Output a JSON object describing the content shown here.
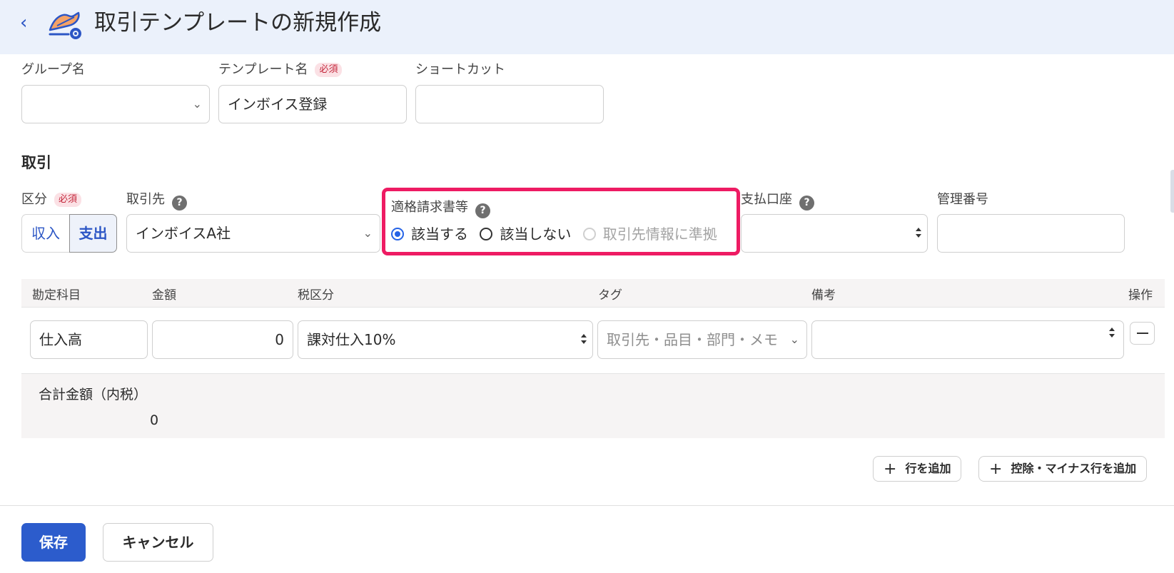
{
  "header": {
    "title": "取引テンプレートの新規作成",
    "back_icon": "chevron-left-icon",
    "logo_icon": "template-gear-icon"
  },
  "template": {
    "group_label": "グループ名",
    "group_value": "",
    "name_label": "テンプレート名",
    "required_badge": "必須",
    "name_value": "インボイス登録",
    "shortcut_label": "ショートカット",
    "shortcut_value": ""
  },
  "deal": {
    "section_title": "取引",
    "type_label": "区分",
    "type_options": [
      "収入",
      "支出"
    ],
    "type_selected": "支出",
    "partner_label": "取引先",
    "partner_value": "インボイスA社",
    "invoice_label": "適格請求書等",
    "invoice_options": [
      "該当する",
      "該当しない",
      "取引先情報に準拠"
    ],
    "invoice_selected": "該当する",
    "account_label": "支払口座",
    "account_value": "",
    "manage_no_label": "管理番号",
    "manage_no_value": "",
    "help_symbol": "?"
  },
  "lines": {
    "headers": [
      "勘定科目",
      "金額",
      "税区分",
      "タグ",
      "備考",
      "操作"
    ],
    "rows": [
      {
        "account": "仕入高",
        "amount": "0",
        "tax": "課対仕入10%",
        "tag_placeholder": "取引先・品目・部門・メモ",
        "memo": ""
      }
    ],
    "total_label": "合計金額（内税）",
    "total_value": "0",
    "add_row": "行を追加",
    "add_minus_row": "控除・マイナス行を追加"
  },
  "footer": {
    "save": "保存",
    "cancel": "キャンセル"
  },
  "colors": {
    "accent": "#2c5ccc",
    "highlight": "#ee1b63",
    "header_bg": "#ebf1fb"
  }
}
